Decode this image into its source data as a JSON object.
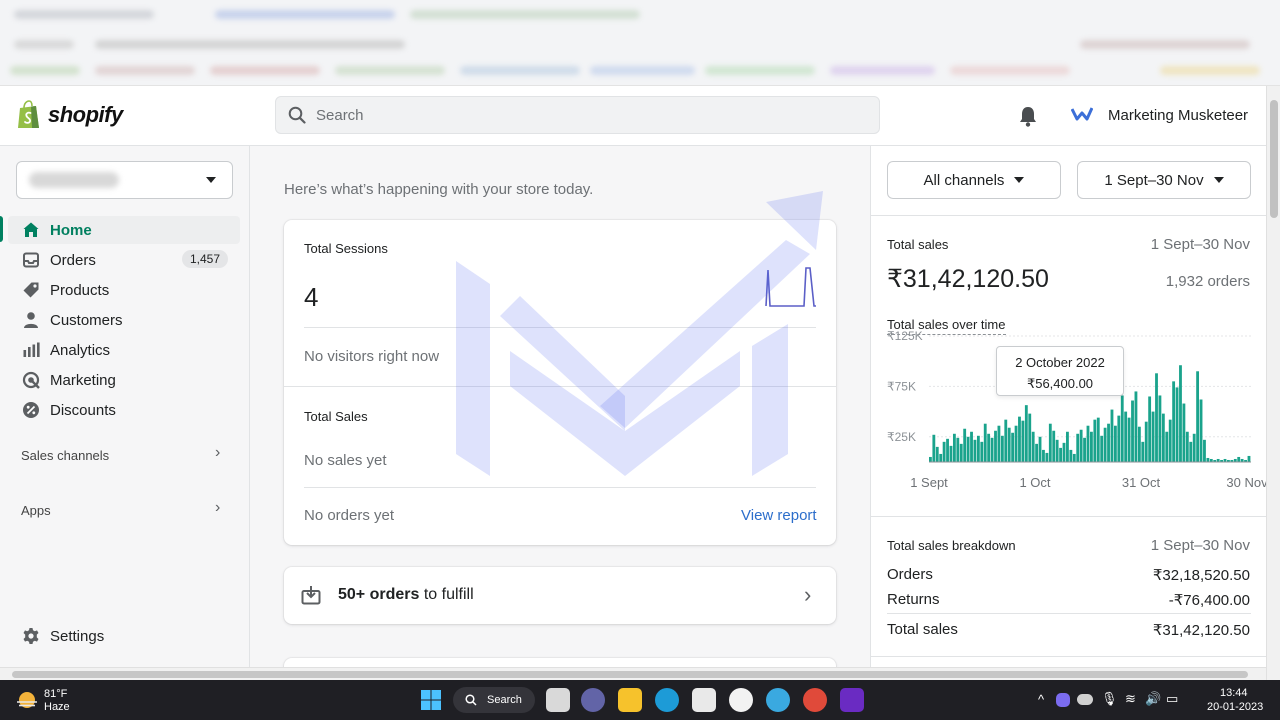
{
  "topbar": {
    "brand": "shopify",
    "search_placeholder": "Search",
    "store_name": "Marketing Musketeer"
  },
  "sidebar": {
    "items": [
      {
        "label": "Home",
        "icon": "home-icon",
        "active": true
      },
      {
        "label": "Orders",
        "icon": "orders-icon",
        "badge": "1,457"
      },
      {
        "label": "Products",
        "icon": "tag-icon"
      },
      {
        "label": "Customers",
        "icon": "person-icon"
      },
      {
        "label": "Analytics",
        "icon": "bar-chart-icon"
      },
      {
        "label": "Marketing",
        "icon": "target-icon"
      },
      {
        "label": "Discounts",
        "icon": "percent-icon"
      }
    ],
    "sales_channels": "Sales channels",
    "apps": "Apps",
    "settings": "Settings"
  },
  "main": {
    "greeting": "Here’s what’s happening with your store today.",
    "sessions_label": "Total Sessions",
    "sessions_value": "4",
    "no_visitors": "No visitors right now",
    "sales_label": "Total Sales",
    "no_sales": "No sales yet",
    "no_orders": "No orders yet",
    "view_report": "View report",
    "fulfill_count": "50+ orders",
    "fulfill_suffix": " to fulfill"
  },
  "right": {
    "channel_filter": "All channels",
    "date_filter": "1 Sept–30 Nov",
    "total_sales_label": "Total sales",
    "total_sales_range": "1 Sept–30 Nov",
    "total_sales_value": "₹31,42,120.50",
    "orders_count": "1,932 orders",
    "over_time_label": "Total sales over time",
    "tooltip_date": "2 October 2022",
    "tooltip_value": "₹56,400.00",
    "breakdown_label": "Total sales breakdown",
    "breakdown_range": "1 Sept–30 Nov",
    "breakdown": [
      {
        "label": "Orders",
        "value": "₹32,18,520.50"
      },
      {
        "label": "Returns",
        "value": "-₹76,400.00"
      },
      {
        "label": "Total sales",
        "value": "₹31,42,120.50"
      }
    ]
  },
  "chart_data": {
    "type": "bar",
    "title": "Total sales over time",
    "y_ticks": [
      "₹125K",
      "₹75K",
      "₹25K"
    ],
    "x_ticks": [
      "1 Sept",
      "1 Oct",
      "31 Oct",
      "30 Nov"
    ],
    "color": "#1aa38c",
    "values": [
      5000,
      27000,
      15000,
      8000,
      20000,
      23000,
      16000,
      28000,
      24000,
      18000,
      33000,
      25000,
      30000,
      22000,
      26000,
      20000,
      38000,
      28000,
      24000,
      31000,
      36000,
      26000,
      42000,
      34000,
      29000,
      36000,
      45000,
      41000,
      56400,
      48000,
      30000,
      18000,
      25000,
      12000,
      9000,
      38000,
      31000,
      22000,
      14000,
      19000,
      30000,
      12000,
      8000,
      28000,
      32000,
      24000,
      36000,
      30000,
      42000,
      44000,
      26000,
      34000,
      38000,
      52000,
      36000,
      46000,
      66000,
      50000,
      44000,
      61000,
      70000,
      35000,
      20000,
      40000,
      65000,
      50000,
      88000,
      66000,
      48000,
      30000,
      42000,
      80000,
      74000,
      96000,
      58000,
      30000,
      20000,
      28000,
      90000,
      62000,
      22000,
      4000,
      3000,
      2000,
      3000,
      2000,
      3000,
      2000,
      2000,
      3000,
      5000,
      3000,
      2000,
      6000
    ],
    "ylim": [
      0,
      125000
    ]
  },
  "taskbar": {
    "weather_temp": "81°F",
    "weather_desc": "Haze",
    "search_label": "Search",
    "time": "13:44",
    "date": "20-01-2023"
  }
}
